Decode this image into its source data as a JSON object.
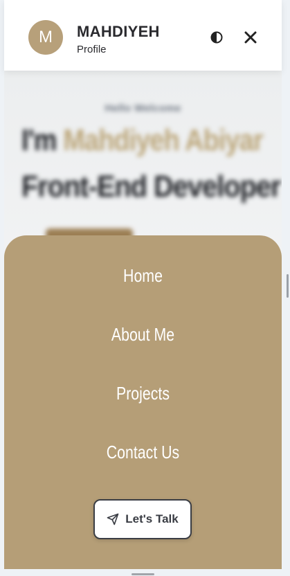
{
  "header": {
    "avatar_letter": "M",
    "name": "MAHDIYEH",
    "subtitle": "Profile",
    "theme_icon": "contrast-icon",
    "close_icon": "close-icon"
  },
  "hero": {
    "greeting": "Hello Welcome",
    "intro_prefix": "I'm ",
    "intro_name": "Mahdiyeh Abiyar",
    "role": "Front-End Developer"
  },
  "menu": {
    "items": [
      {
        "label": "Home"
      },
      {
        "label": "About Me"
      },
      {
        "label": "Projects"
      },
      {
        "label": "Contact Us"
      }
    ],
    "cta_label": "Let's Talk",
    "cta_icon": "paper-plane-icon"
  },
  "colors": {
    "accent": "#b59e77",
    "avatar": "#b7a07a",
    "text_dark": "#2a2a2e"
  }
}
